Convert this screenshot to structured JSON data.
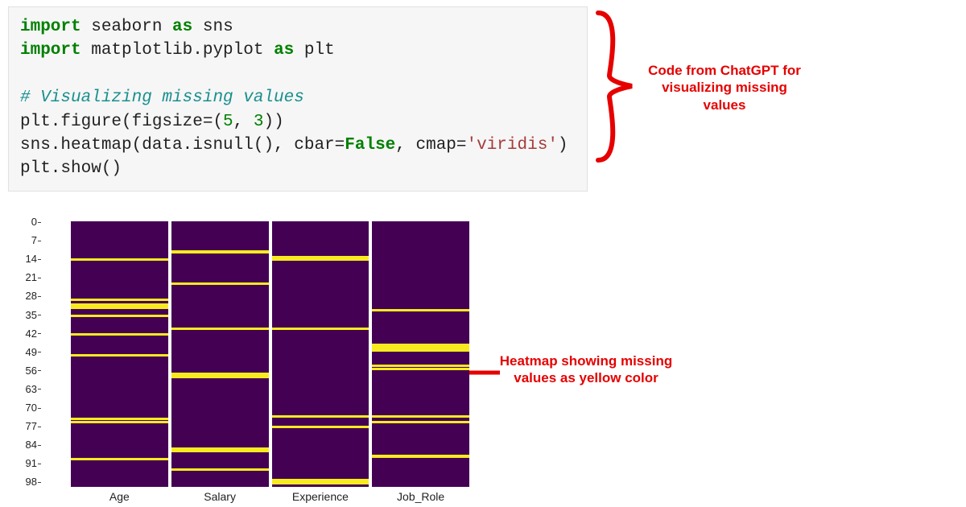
{
  "code": {
    "line1_kw1": "import",
    "line1_rest": " seaborn ",
    "line1_kw2": "as",
    "line1_rest2": " sns",
    "line2_kw1": "import",
    "line2_rest": " matplotlib.pyplot ",
    "line2_kw2": "as",
    "line2_rest2": " plt",
    "line4_comment": "# Visualizing missing values",
    "line5_a": "plt.figure(figsize=(",
    "line5_n1": "5",
    "line5_b": ", ",
    "line5_n2": "3",
    "line5_c": "))",
    "line6_a": "sns.heatmap(data.isnull(), cbar=",
    "line6_bool": "False",
    "line6_b": ", cmap=",
    "line6_str": "'viridis'",
    "line6_c": ")",
    "line7": "plt.show()"
  },
  "annotations": {
    "code_note": "Code from ChatGPT for visualizing missing values",
    "heatmap_note": "Heatmap showing missing values as yellow color"
  },
  "chart_data": {
    "type": "heatmap",
    "x_labels": [
      "Age",
      "Salary",
      "Experience",
      "Job_Role"
    ],
    "y_ticks": [
      0,
      7,
      14,
      21,
      28,
      35,
      42,
      49,
      56,
      63,
      70,
      77,
      84,
      91,
      98
    ],
    "n_rows": 100,
    "colors": {
      "background": "#440154",
      "missing": "#f7eb20"
    },
    "missing": {
      "Age": [
        14,
        29,
        31,
        32,
        35,
        42,
        50,
        74,
        75,
        89
      ],
      "Salary": [
        11,
        23,
        40,
        57,
        58,
        85,
        86,
        93
      ],
      "Experience": [
        13,
        14,
        40,
        73,
        77,
        97,
        98
      ],
      "Job_Role": [
        33,
        46,
        47,
        48,
        54,
        55,
        73,
        75,
        88
      ]
    }
  }
}
